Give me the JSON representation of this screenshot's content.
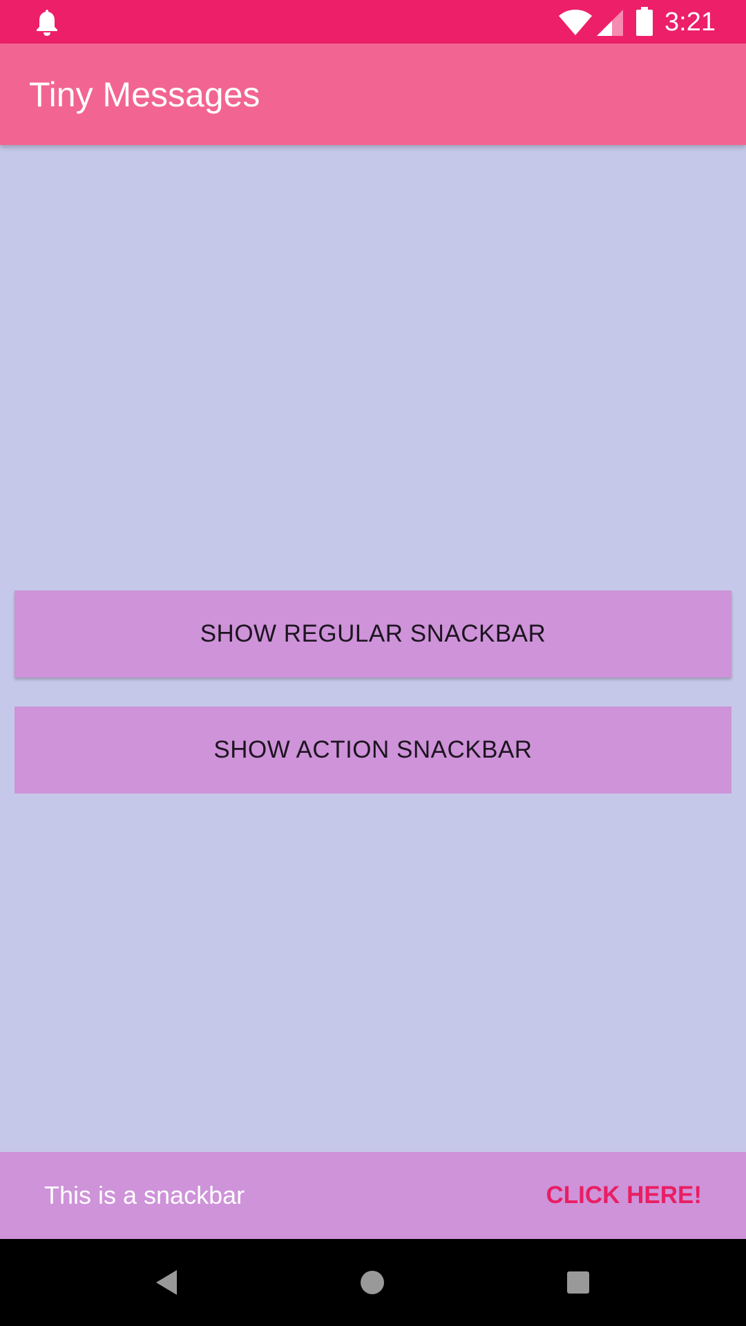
{
  "status_bar": {
    "time": "3:21",
    "background": "#ec1f68",
    "icons": [
      "notification-bell-icon",
      "wifi-icon",
      "cell-signal-icon",
      "battery-icon"
    ]
  },
  "app_bar": {
    "title": "Tiny Messages",
    "background": "#f26592"
  },
  "main": {
    "background": "#c5c8e8",
    "buttons": [
      {
        "label": "SHOW REGULAR SNACKBAR"
      },
      {
        "label": "SHOW ACTION SNACKBAR"
      }
    ],
    "button_color": "#ce93d9"
  },
  "snackbar": {
    "message": "This is a snackbar",
    "action_label": "CLICK HERE!",
    "action_color": "#e91e63"
  },
  "nav_bar": {
    "icons": [
      "back-icon",
      "home-icon",
      "recents-icon"
    ]
  }
}
